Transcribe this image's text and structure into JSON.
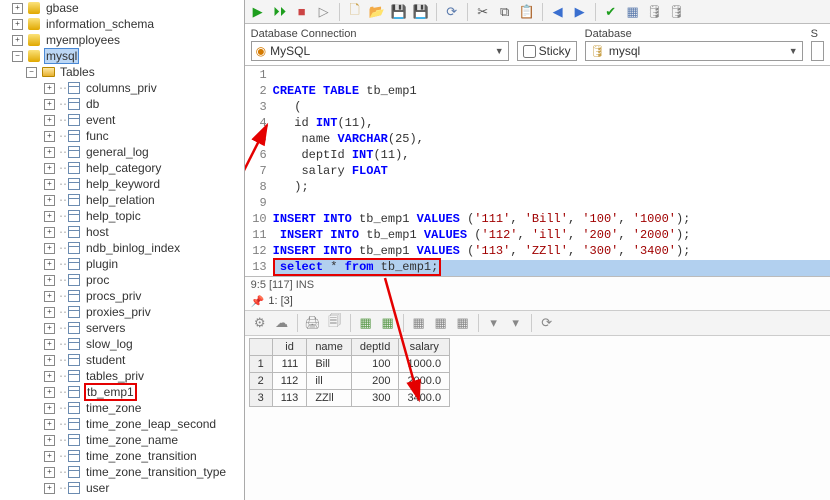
{
  "sidebar": {
    "roots": [
      {
        "label": "gbase",
        "icon": "cyl"
      },
      {
        "label": "information_schema",
        "icon": "cyl"
      },
      {
        "label": "myemployees",
        "icon": "cyl"
      },
      {
        "label": "mysql",
        "icon": "cyl",
        "selected": true
      }
    ],
    "tablesFolder": "Tables",
    "tables": [
      "columns_priv",
      "db",
      "event",
      "func",
      "general_log",
      "help_category",
      "help_keyword",
      "help_relation",
      "help_topic",
      "host",
      "ndb_binlog_index",
      "plugin",
      "proc",
      "procs_priv",
      "proxies_priv",
      "servers",
      "slow_log",
      "student",
      "tables_priv",
      "tb_emp1",
      "time_zone",
      "time_zone_leap_second",
      "time_zone_name",
      "time_zone_transition",
      "time_zone_transition_type",
      "user"
    ],
    "highlightTable": "tb_emp1"
  },
  "toolbar": {
    "icons": [
      {
        "name": "run-icon",
        "g": "▶",
        "c": "#1e9e1e"
      },
      {
        "name": "run-all-icon",
        "g": "⏵⏵",
        "c": "#1e9e1e"
      },
      {
        "name": "stop-icon",
        "g": "■",
        "c": "#c44"
      },
      {
        "name": "step-icon",
        "g": "▷",
        "c": "#888"
      },
      {
        "name": "sep"
      },
      {
        "name": "new-icon",
        "g": "🗋",
        "c": "#caa24b"
      },
      {
        "name": "open-icon",
        "g": "📂",
        "c": "#caa24b"
      },
      {
        "name": "save-icon",
        "g": "💾",
        "c": "#5a7aad"
      },
      {
        "name": "saveall-icon",
        "g": "💾",
        "c": "#5a7aad"
      },
      {
        "name": "sep"
      },
      {
        "name": "refresh-icon",
        "g": "⟳",
        "c": "#5a7aad"
      },
      {
        "name": "sep"
      },
      {
        "name": "cut-icon",
        "g": "✂",
        "c": "#555"
      },
      {
        "name": "copy-icon",
        "g": "⧉",
        "c": "#555"
      },
      {
        "name": "paste-icon",
        "g": "📋",
        "c": "#555"
      },
      {
        "name": "sep"
      },
      {
        "name": "undo-icon",
        "g": "◀",
        "c": "#3a6fcf"
      },
      {
        "name": "redo-icon",
        "g": "▶",
        "c": "#3a6fcf"
      },
      {
        "name": "sep"
      },
      {
        "name": "commit-icon",
        "g": "✔",
        "c": "#1e9e1e"
      },
      {
        "name": "browse-icon",
        "g": "▦",
        "c": "#5a7aad"
      },
      {
        "name": "db-icon",
        "g": "🛢",
        "c": "#888"
      },
      {
        "name": "db2-icon",
        "g": "🛢",
        "c": "#888"
      }
    ]
  },
  "connection": {
    "label": "Database Connection",
    "value": "MySQL",
    "sticky_label": "Sticky",
    "db_label": "Database",
    "db_value": "mysql",
    "s_label": "S"
  },
  "sql": {
    "lines": [
      {
        "n": 1,
        "t": ""
      },
      {
        "n": 2,
        "h": "<span class='kw'>CREATE TABLE</span> tb_emp1"
      },
      {
        "n": 3,
        "h": "   ("
      },
      {
        "n": 4,
        "h": "   id <span class='kw'>INT</span>(11),"
      },
      {
        "n": 5,
        "h": "    name <span class='kw'>VARCHAR</span>(25),"
      },
      {
        "n": 6,
        "h": "    deptId <span class='kw'>INT</span>(11),"
      },
      {
        "n": 7,
        "h": "    salary <span class='kw'>FLOAT</span>"
      },
      {
        "n": 8,
        "h": "   );"
      },
      {
        "n": 9,
        "h": ""
      },
      {
        "n": 10,
        "h": "<span class='kw'>INSERT INTO</span> tb_emp1 <span class='kw'>VALUES</span> (<span class='str'>'111'</span>, <span class='str'>'Bill'</span>, <span class='str'>'100'</span>, <span class='str'>'1000'</span>);"
      },
      {
        "n": 11,
        "h": " <span class='kw'>INSERT INTO</span> tb_emp1 <span class='kw'>VALUES</span> (<span class='str'>'112'</span>, <span class='str'>'ill'</span>, <span class='str'>'200'</span>, <span class='str'>'2000'</span>);"
      },
      {
        "n": 12,
        "h": "<span class='kw'>INSERT INTO</span> tb_emp1 <span class='kw'>VALUES</span> (<span class='str'>'113'</span>, <span class='str'>'ZZll'</span>, <span class='str'>'300'</span>, <span class='str'>'3400'</span>);"
      },
      {
        "n": 13,
        "h": " <span class='kw'>select</span> * <span class='kw'>from</span> tb_emp1;",
        "sel": true
      }
    ]
  },
  "status": "9:5 [117]  INS",
  "result_label": "1:   [3]",
  "rtoolbar": {
    "icons": [
      {
        "name": "grid-gear-icon",
        "g": "⚙",
        "c": "#888"
      },
      {
        "name": "grid-cloud-icon",
        "g": "☁",
        "c": "#888"
      },
      {
        "name": "sep"
      },
      {
        "name": "grid-print-icon",
        "g": "🖨",
        "c": "#888"
      },
      {
        "name": "grid-export-icon",
        "g": "🗐",
        "c": "#888"
      },
      {
        "name": "sep"
      },
      {
        "name": "grid-add-icon",
        "g": "▦",
        "c": "#5a9a4a"
      },
      {
        "name": "grid-addg-icon",
        "g": "▦",
        "c": "#5a9a4a"
      },
      {
        "name": "sep"
      },
      {
        "name": "grid-del-icon",
        "g": "▦",
        "c": "#888"
      },
      {
        "name": "grid-del2-icon",
        "g": "▦",
        "c": "#888"
      },
      {
        "name": "grid-clone-icon",
        "g": "▦",
        "c": "#888"
      },
      {
        "name": "sep"
      },
      {
        "name": "grid-nav1-icon",
        "g": "▾",
        "c": "#888"
      },
      {
        "name": "grid-nav2-icon",
        "g": "▾",
        "c": "#888"
      },
      {
        "name": "sep"
      },
      {
        "name": "grid-opt-icon",
        "g": "⟳",
        "c": "#888"
      }
    ]
  },
  "grid": {
    "cols": [
      "id",
      "name",
      "deptId",
      "salary"
    ],
    "rows": [
      {
        "id": 111,
        "name": "Bill",
        "deptId": 100,
        "salary": "1000.0"
      },
      {
        "id": 112,
        "name": "ill",
        "deptId": 200,
        "salary": "2000.0"
      },
      {
        "id": 113,
        "name": "ZZll",
        "deptId": 300,
        "salary": "3400.0"
      }
    ]
  }
}
